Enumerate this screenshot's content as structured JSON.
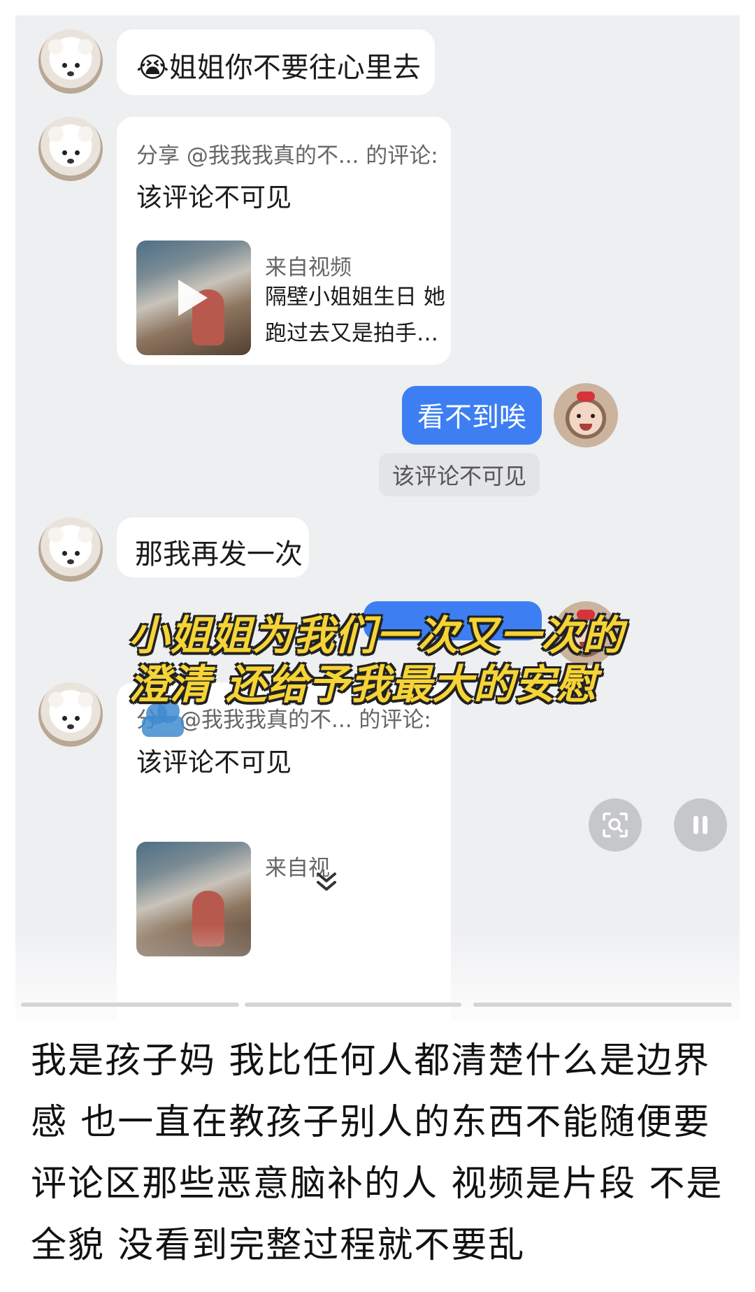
{
  "chat": {
    "msg1": "😭姐姐你不要往心里去",
    "share1": {
      "header": "分享 @我我我真的不... 的评论:",
      "body": "该评论不可见",
      "source_label": "来自视频",
      "source_title": "隔壁小姐姐生日 她跑过去又是拍手…"
    },
    "reply1": "看不到唉",
    "notice1": "该评论不可见",
    "msg2": "那我再发一次",
    "share2": {
      "header": "@我我我真的不... 的评论:",
      "header_prefix": "分",
      "body": "该评论不可见",
      "source_label": "来自视"
    }
  },
  "overlay": {
    "line1": "小姐姐为我们一次又一次的",
    "line2": "澄清 还给予我最大的安慰"
  },
  "caption": "我是孩子妈 我比任何人都清楚什么是边界感 也一直在教孩子别人的东西不能随便要 评论区那些恶意脑补的人 视频是片段 不是全貌 没看到完整过程就不要乱",
  "colors": {
    "chat_background": "#eeeff1",
    "sent_bubble": "#3d7ff2",
    "overlay_text": "#f6d435"
  },
  "icons": [
    "bear-avatar-icon",
    "baby-avatar-icon",
    "play-icon",
    "search-scan-icon",
    "pause-icon",
    "chevron-down-icon"
  ]
}
